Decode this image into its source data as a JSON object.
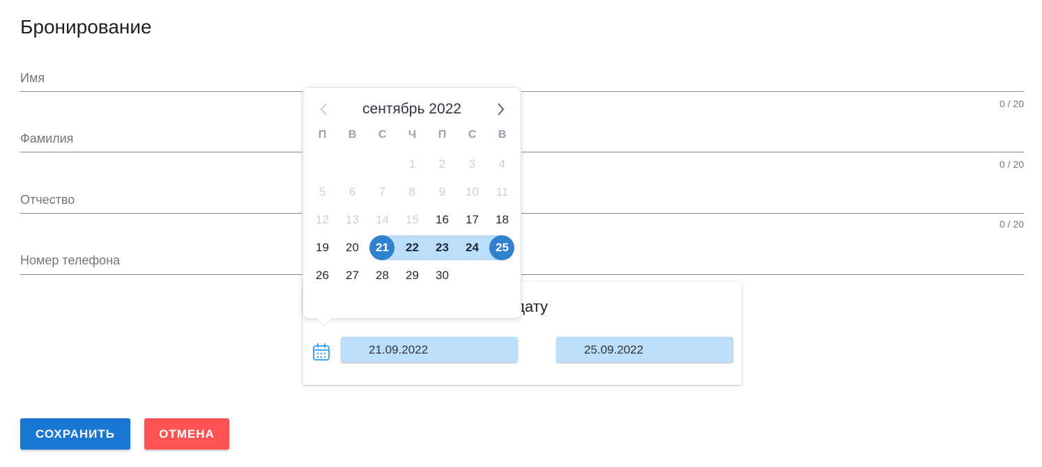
{
  "page": {
    "title": "Бронирование"
  },
  "fields": [
    {
      "label": "Имя",
      "counter": "0 / 20"
    },
    {
      "label": "Фамилия",
      "counter": "0 / 20"
    },
    {
      "label": "Отчество",
      "counter": "0 / 20"
    },
    {
      "label": "Номер телефона",
      "counter": ""
    }
  ],
  "date_card": {
    "title_visible": "те дату",
    "start_value": "21.09.2022",
    "end_value": "25.09.2022",
    "icon": "calendar-icon"
  },
  "picker": {
    "month_title": "сентябрь 2022",
    "prev_icon": "chevron-left-icon",
    "next_icon": "chevron-right-icon",
    "weekdays": [
      "П",
      "В",
      "С",
      "Ч",
      "П",
      "С",
      "В"
    ],
    "weeks": [
      [
        "",
        "",
        "",
        "1",
        "2",
        "3",
        "4"
      ],
      [
        "5",
        "6",
        "7",
        "8",
        "9",
        "10",
        "11"
      ],
      [
        "12",
        "13",
        "14",
        "15",
        "16",
        "17",
        "18"
      ],
      [
        "19",
        "20",
        "21",
        "22",
        "23",
        "24",
        "25"
      ],
      [
        "26",
        "27",
        "28",
        "29",
        "30",
        "",
        ""
      ]
    ],
    "disabled_through": 15,
    "range_start": 21,
    "range_end": 25,
    "colors": {
      "selected": "#3182ce",
      "range": "#bbdefb",
      "disabled": "#c5cfdb"
    }
  },
  "buttons": {
    "save": "СОХРАНИТЬ",
    "cancel": "ОТМЕНА",
    "save_color": "#1976d2",
    "cancel_color": "#ff5252"
  }
}
